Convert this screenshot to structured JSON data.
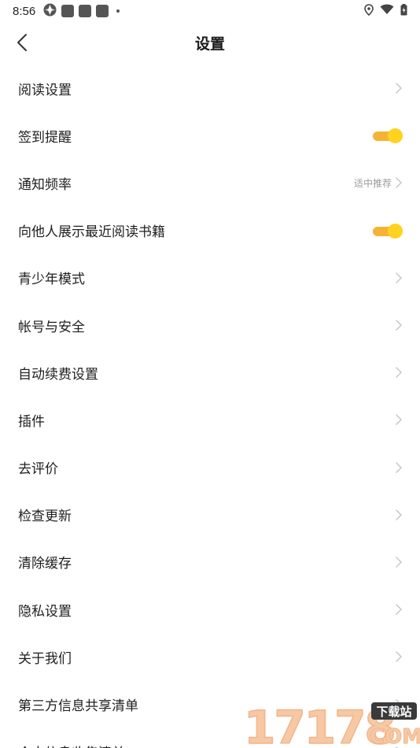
{
  "status_bar": {
    "time": "8:56",
    "icons": [
      "app-icon",
      "notification-square-icon",
      "notification-square-icon",
      "notification-square-icon",
      "more-dot-icon",
      "location-icon",
      "wifi-icon",
      "battery-charging-icon"
    ]
  },
  "header": {
    "title": "设置",
    "back_icon": "chevron-left-icon"
  },
  "settings": {
    "items": [
      {
        "label": "阅读设置",
        "control": "chevron"
      },
      {
        "label": "签到提醒",
        "control": "toggle",
        "on": true
      },
      {
        "label": "通知频率",
        "value": "适中推荐",
        "control": "chevron"
      },
      {
        "label": "向他人展示最近阅读书籍",
        "control": "toggle",
        "on": true
      },
      {
        "label": "青少年模式",
        "control": "chevron"
      },
      {
        "label": "帐号与安全",
        "control": "chevron"
      },
      {
        "label": "自动续费设置",
        "control": "chevron"
      },
      {
        "label": "插件",
        "control": "chevron"
      },
      {
        "label": "去评价",
        "control": "chevron"
      },
      {
        "label": "检查更新",
        "control": "chevron"
      },
      {
        "label": "清除缓存",
        "control": "chevron"
      },
      {
        "label": "隐私设置",
        "control": "chevron"
      },
      {
        "label": "关于我们",
        "control": "chevron"
      },
      {
        "label": "第三方信息共享清单",
        "control": "chevron"
      },
      {
        "label": "个人信息收集清单",
        "control": "chevron"
      }
    ]
  },
  "watermark": {
    "number": "17178",
    "badge": "下载站",
    "suffix": "COM"
  },
  "colors": {
    "toggle_track": "#f5b335",
    "toggle_knob": "#ffd21f",
    "chevron": "#c4c4c4",
    "secondary_text": "#9a9a9a"
  }
}
